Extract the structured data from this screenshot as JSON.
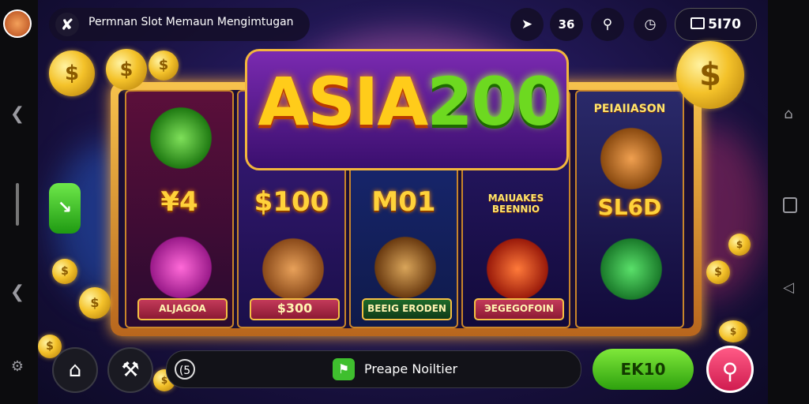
{
  "app": {
    "title": "Permnan Slot Memaun Mengimtugan",
    "logo_line_a": "ASIA",
    "logo_line_b": "200",
    "balance": "5I70"
  },
  "topbar": {
    "buttons": [
      "rocket-icon",
      "36",
      "search-icon",
      "clock-icon"
    ],
    "btn2_label": "Ж"
  },
  "reels": [
    {
      "top_icon": "rocket-icon",
      "value": "¥4",
      "bottom_label": "ALJAGOA"
    },
    {
      "value": "$100",
      "bottom_label": "$300"
    },
    {
      "value": "M01",
      "bottom_label": "BEEIG ERODEN"
    },
    {
      "subtitle": "MAIUAKES BEENNIO",
      "bottom_label": "ЭEGEGOFOIN"
    },
    {
      "title": "PEIAIIASON",
      "value": "SL6D"
    }
  ],
  "bottom": {
    "circle_label": "(5",
    "pill_text": "Preape Noiltier",
    "exit_label": "EK10"
  },
  "colors": {
    "accent_gold": "#f7c34d",
    "accent_green": "#2ea10e",
    "accent_pink": "#d01c50",
    "bg_purple": "#241a5c"
  }
}
